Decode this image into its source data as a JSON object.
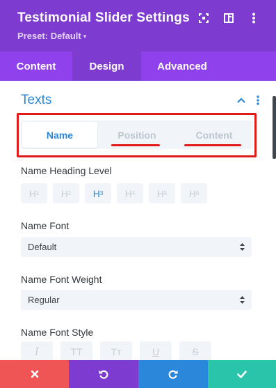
{
  "header": {
    "title": "Testimonial Slider Settings",
    "preset_label": "Preset: Default",
    "icons": [
      "expand-icon",
      "sidebar-layout-icon",
      "more-vertical-icon"
    ]
  },
  "tabs": [
    {
      "label": "Content",
      "active": false
    },
    {
      "label": "Design",
      "active": true
    },
    {
      "label": "Advanced",
      "active": false
    }
  ],
  "section": {
    "title": "Texts",
    "icons": [
      "chevron-up-icon",
      "more-vertical-icon"
    ],
    "subtabs": [
      {
        "label": "Name",
        "active": true
      },
      {
        "label": "Position",
        "active": false
      },
      {
        "label": "Content",
        "active": false
      }
    ]
  },
  "fields": {
    "heading_level": {
      "label": "Name Heading Level",
      "options": [
        {
          "main": "H",
          "sub": "1",
          "active": false
        },
        {
          "main": "H",
          "sub": "2",
          "active": false
        },
        {
          "main": "H",
          "sub": "3",
          "active": true
        },
        {
          "main": "H",
          "sub": "4",
          "active": false
        },
        {
          "main": "H",
          "sub": "5",
          "active": false
        },
        {
          "main": "H",
          "sub": "6",
          "active": false
        }
      ]
    },
    "font": {
      "label": "Name Font",
      "value": "Default"
    },
    "font_weight": {
      "label": "Name Font Weight",
      "value": "Regular"
    },
    "font_style": {
      "label": "Name Font Style",
      "options": [
        "italic-icon",
        "uppercase-icon",
        "capitalize-icon",
        "underline-icon",
        "strikethrough-icon"
      ],
      "glyphs": [
        "I",
        "TT",
        "Tт",
        "U",
        "S"
      ]
    }
  },
  "footer": {
    "buttons": [
      "close-icon",
      "undo-icon",
      "redo-icon",
      "check-icon"
    ]
  },
  "colors": {
    "header_purple": "#7e3bd0",
    "tab_purple": "#8f42ec",
    "accent_blue": "#2b87da",
    "highlight_red": "#e11a1a",
    "cancel_red": "#ef5555",
    "save_green": "#29c4a9"
  }
}
